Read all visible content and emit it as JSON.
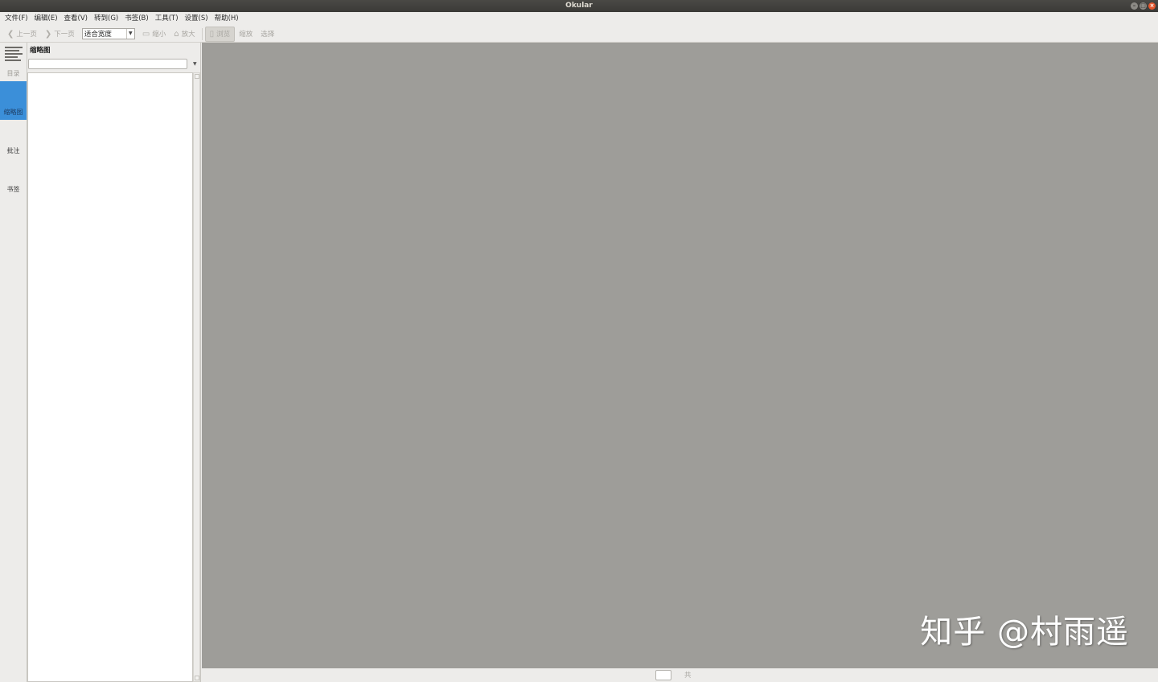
{
  "window": {
    "title": "Okular"
  },
  "menubar": {
    "items": [
      "文件(F)",
      "编辑(E)",
      "查看(V)",
      "转到(G)",
      "书签(B)",
      "工具(T)",
      "设置(S)",
      "帮助(H)"
    ]
  },
  "toolbar": {
    "prev_label": "上一页",
    "next_label": "下一页",
    "zoom_value": "适合宽度",
    "zoom_out_label": "缩小",
    "zoom_in_label": "放大",
    "browse_label": "浏览",
    "zoom_tool_label": "缩放",
    "select_label": "选择"
  },
  "sidetabs": {
    "items": [
      {
        "label": "目录",
        "icon": "toc-icon",
        "state": "disabled"
      },
      {
        "label": "缩略图",
        "state": "selected"
      },
      {
        "label": "批注",
        "state": "normal"
      },
      {
        "label": "书签",
        "state": "normal"
      }
    ]
  },
  "panel": {
    "title": "缩略图",
    "filter_value": ""
  },
  "pagebar": {
    "current_page": "",
    "total_label": "共"
  },
  "watermark": {
    "text": "知乎 @村雨遥"
  },
  "colors": {
    "accent": "#3b8fd9",
    "document_background": "#9e9d99",
    "titlebar": "#3b3a37",
    "close_button": "#e4572e"
  }
}
